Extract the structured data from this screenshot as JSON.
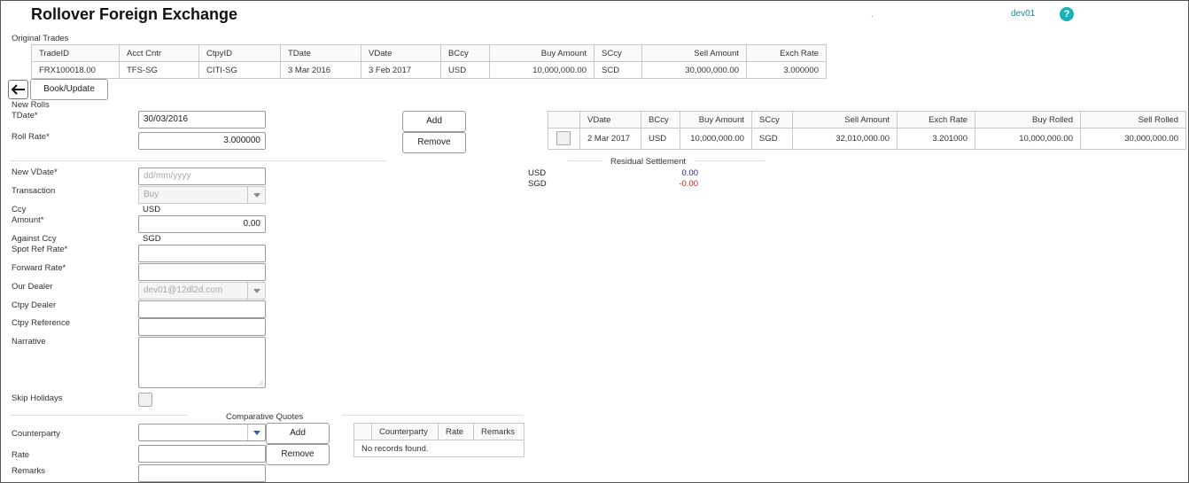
{
  "header": {
    "title": "Rollover Foreign Exchange",
    "dot": ".",
    "user": "dev01",
    "help_glyph": "?"
  },
  "original_trades": {
    "label": "Original Trades",
    "columns": [
      "TradeID",
      "Acct Cntr",
      "CtpyID",
      "TDate",
      "VDate",
      "BCcy",
      "Buy Amount",
      "SCcy",
      "Sell Amount",
      "Exch Rate"
    ],
    "rows": [
      [
        "FRX100018.00",
        "TFS-SG",
        "CITI-SG",
        "3 Mar 2016",
        "3 Feb 2017",
        "USD",
        "10,000,000.00",
        "SCD",
        "30,000,000.00",
        "3.000000"
      ]
    ]
  },
  "toolbar": {
    "back_icon": "arrow-left-icon",
    "book_update_label": "Book/Update"
  },
  "new_rolls": {
    "label": "New Rolls",
    "tdate_label": "TDate*",
    "tdate_value": "30/03/2016",
    "roll_rate_label": "Roll Rate*",
    "roll_rate_value": "3.000000",
    "add_label": "Add",
    "remove_label": "Remove"
  },
  "form": {
    "new_vdate_label": "New VDate*",
    "new_vdate_placeholder": "dd/mm/yyyy",
    "transaction_label": "Transaction",
    "transaction_value": "Buy",
    "ccy_label": "Ccy",
    "ccy_value": "USD",
    "amount_label": "Amount*",
    "amount_value": "0.00",
    "against_ccy_label": "Against Ccy",
    "against_ccy_value": "SGD",
    "spot_ref_rate_label": "Spot Ref Rate*",
    "forward_rate_label": "Forward Rate*",
    "our_dealer_label": "Our Dealer",
    "our_dealer_value": "dev01@12dl2d.com",
    "ctpy_dealer_label": "Ctpy Dealer",
    "ctpy_reference_label": "Ctpy Reference",
    "narrative_label": "Narrative",
    "skip_holidays_label": "Skip Holidays"
  },
  "comparative_quotes": {
    "label": "Comparative Quotes",
    "counterparty_label": "Counterparty",
    "rate_label": "Rate",
    "remarks_label": "Remarks",
    "add_label": "Add",
    "remove_label": "Remove",
    "columns": [
      "Counterparty",
      "Rate",
      "Remarks"
    ],
    "empty_text": "No records found."
  },
  "rolls_table": {
    "columns": [
      "VDate",
      "BCcy",
      "Buy Amount",
      "SCcy",
      "Sell Amount",
      "Exch Rate",
      "Buy Rolled",
      "Sell Rolled"
    ],
    "rows": [
      [
        "2 Mar 2017",
        "USD",
        "10,000,000.00",
        "SGD",
        "32,010,000.00",
        "3.201000",
        "10,000,000.00",
        "30,000,000.00"
      ]
    ]
  },
  "residual_settlement": {
    "label": "Residual Settlement",
    "items": [
      {
        "ccy": "USD",
        "value": "0.00",
        "color": "#1a1aa0"
      },
      {
        "ccy": "SGD",
        "value": "-0.00",
        "color": "#cc1a1a"
      }
    ]
  }
}
